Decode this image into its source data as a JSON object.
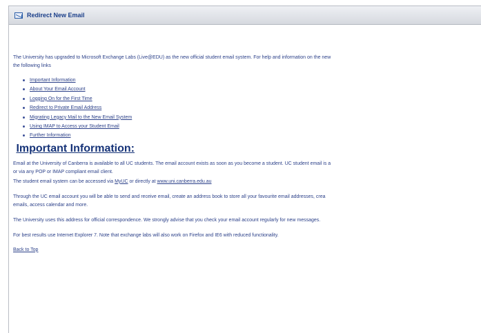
{
  "header": {
    "title": "Redirect New Email",
    "icon": "envelope-icon"
  },
  "intro": {
    "line1": "The University has upgraded to Microsoft Exchange Labs (Live@EDU) as the new official student email system. For help and information on the new",
    "line2": "the following links"
  },
  "links": [
    "Important Information",
    "About Your Email Account",
    "Logging On for the First Time",
    "Redirect to Private Email Address",
    "Migrating Legacy Mail to the New Email System",
    "Using IMAP to Access your Student Email",
    "Further Information"
  ],
  "section": {
    "heading": "Important Information:",
    "p1_line1": "Email at the University of Canberra is available to all UC students. The email account exists as soon as you become a student. UC student email is a",
    "p1_line2": "or via any POP or IMAP compliant email client.",
    "p2_prefix": "The student email system can be accessed via ",
    "p2_link1": "MyUC",
    "p2_middle": " or directly at ",
    "p2_link2": "www.uni.canberra.edu.au",
    "p3_line1": "Through the UC email account you will be able to send and receive email, create an address book to store all your favourite email addresses, crea",
    "p3_line2": "emails, access calendar and more.",
    "p4": "The University uses this address for official correspondence. We strongly advise that you check your email account regularly for new messages.",
    "p5": "For best results use Internet Explorer 7. Note that exchange labs will also work on Firefox and IE6 with reduced functionality.",
    "back_to_top": "Back to Top"
  }
}
